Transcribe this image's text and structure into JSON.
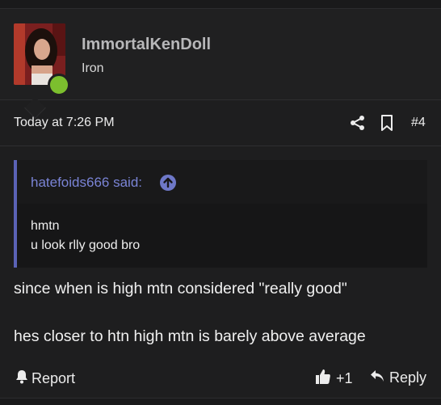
{
  "post": {
    "author": "ImmortalKenDoll",
    "author_title": "Iron",
    "timestamp": "Today at 7:26 PM",
    "post_number": "#4",
    "quote": {
      "author_label": "hatefoids666 said:",
      "lines": [
        "hmtn",
        "u look rlly good bro"
      ]
    },
    "body": [
      "since when is high mtn considered \"really good\"",
      "hes closer to htn high mtn is barely above average"
    ],
    "actions": {
      "report_label": "Report",
      "like_label": "+1",
      "reply_label": "Reply"
    }
  },
  "icons": {
    "share": "share-icon",
    "bookmark": "bookmark-icon",
    "quote_jump": "arrow-up-circle-icon",
    "report": "bell-icon",
    "like": "thumbs-up-icon",
    "reply": "reply-arrow-icon"
  },
  "colors": {
    "background": "#1e1e1f",
    "quote_accent": "#5b63b6",
    "quote_author": "#7a84d6",
    "online_indicator": "#7cbf2e"
  }
}
